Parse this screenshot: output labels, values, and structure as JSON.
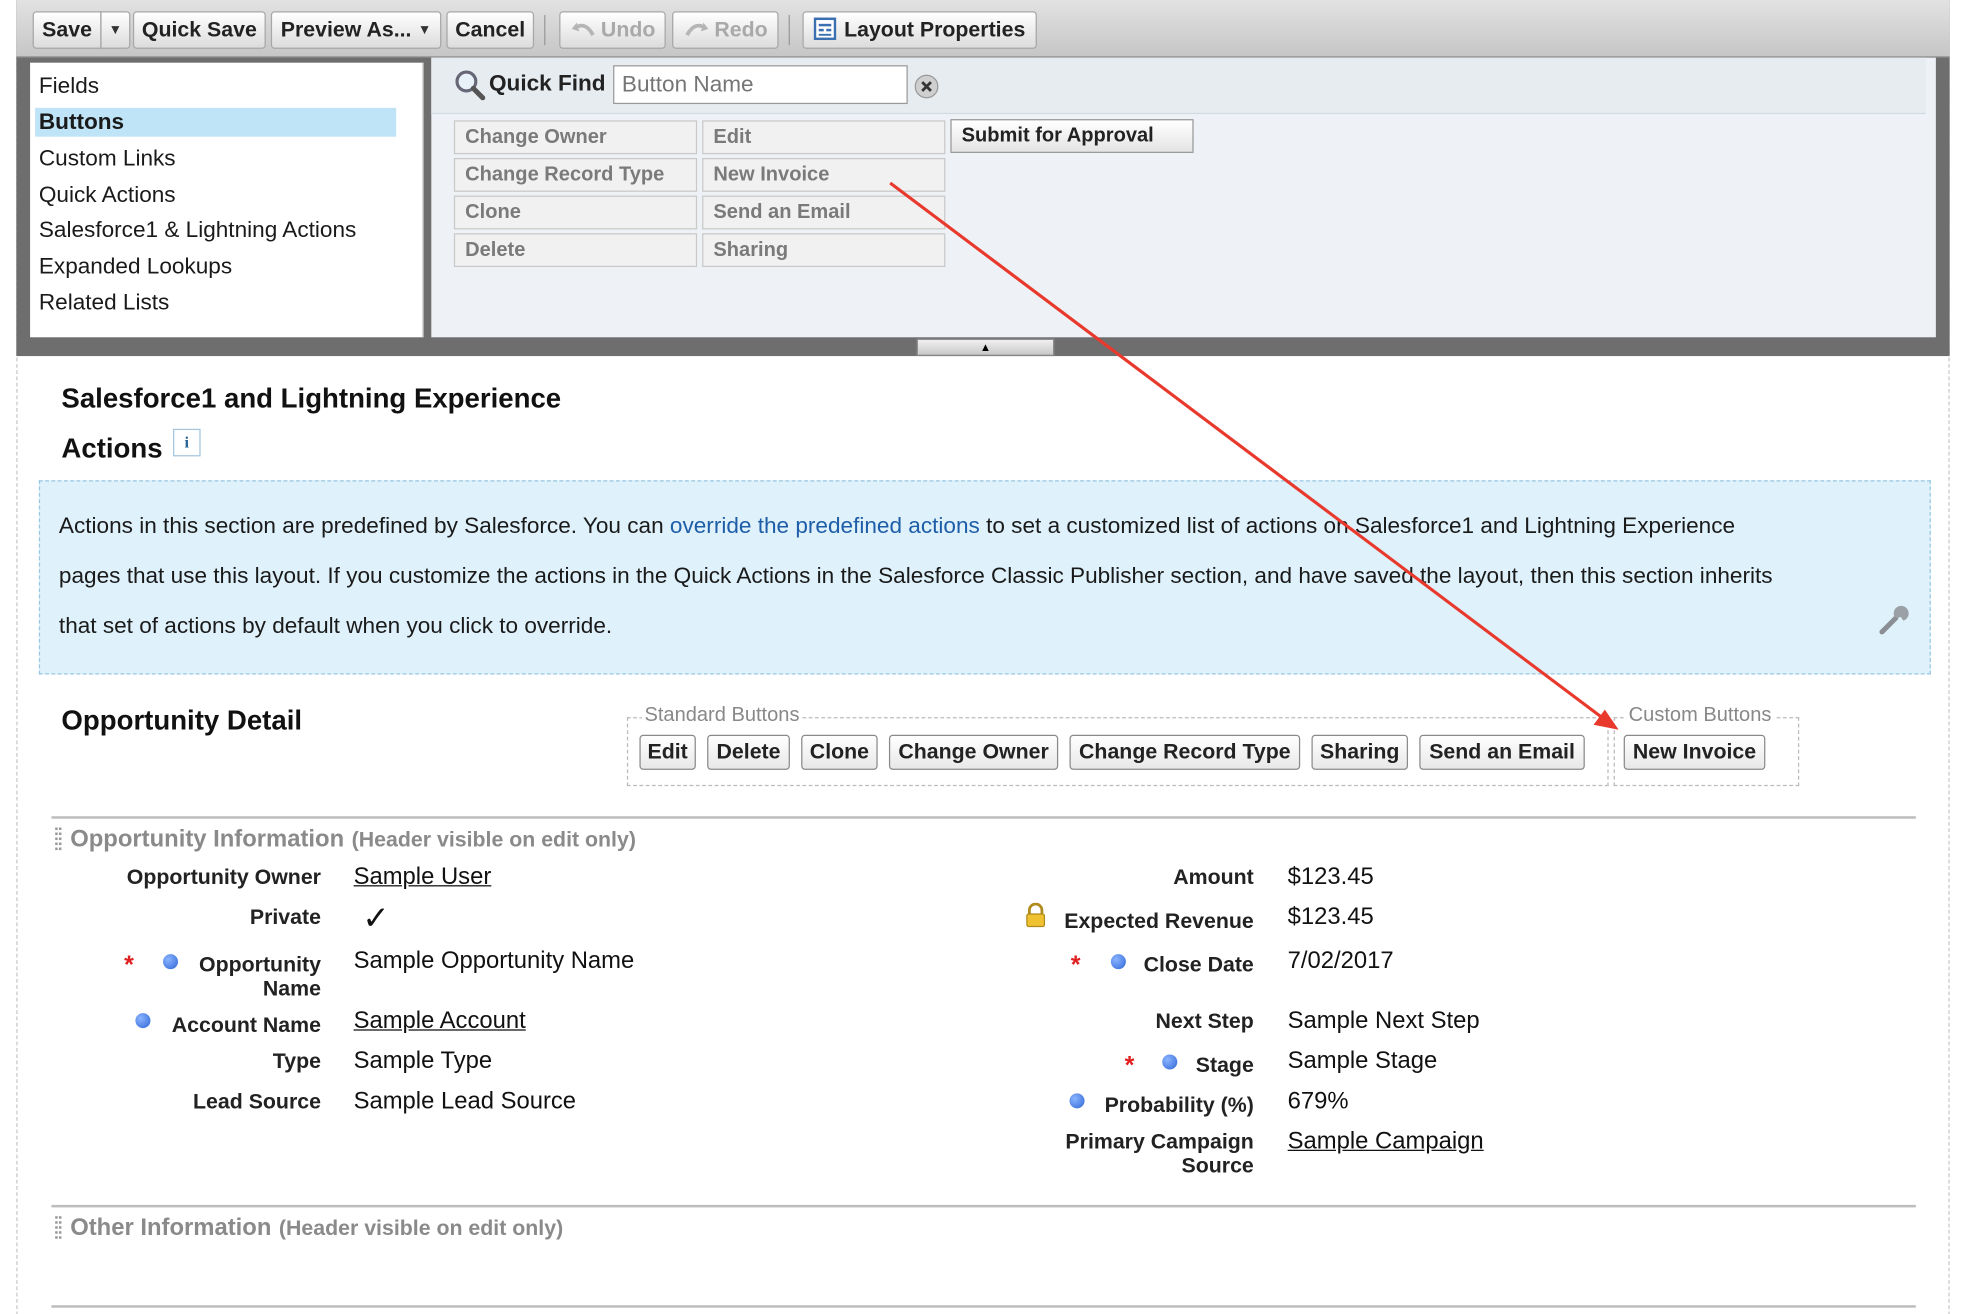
{
  "toolbar": {
    "save": "Save",
    "quick_save": "Quick Save",
    "preview_as": "Preview As...",
    "cancel": "Cancel",
    "undo": "Undo",
    "redo": "Redo",
    "layout_properties": "Layout Properties"
  },
  "palette": {
    "categories": [
      "Fields",
      "Buttons",
      "Custom Links",
      "Quick Actions",
      "Salesforce1 & Lightning Actions",
      "Expanded Lookups",
      "Related Lists"
    ],
    "selected_category": "Buttons",
    "quick_find": {
      "label": "Quick Find",
      "placeholder": "Button Name"
    },
    "buttons_col1": [
      "Change Owner",
      "Change Record Type",
      "Clone",
      "Delete"
    ],
    "buttons_col2": [
      "Edit",
      "New Invoice",
      "Send an Email",
      "Sharing"
    ],
    "buttons_col3": [
      "Submit for Approval"
    ]
  },
  "actions_section": {
    "title": "Salesforce1 and Lightning Experience",
    "subtitle": "Actions",
    "info": "i",
    "notice_line1_a": "Actions in this section are predefined by Salesforce. You can ",
    "notice_link": "override the predefined actions",
    "notice_line1_b": " to set a customized list of actions on Salesforce1 and Lightning Experience",
    "notice_line2": "pages that use this layout. If you customize the actions in the Quick Actions in the Salesforce Classic Publisher section, and have saved the layout, then this section inherits",
    "notice_line3": "that set of actions by default when you click to override."
  },
  "detail": {
    "title": "Opportunity Detail",
    "standard_legend": "Standard Buttons",
    "standard_buttons": [
      "Edit",
      "Delete",
      "Clone",
      "Change Owner",
      "Change Record Type",
      "Sharing",
      "Send an Email"
    ],
    "custom_legend": "Custom Buttons",
    "custom_buttons": [
      "New Invoice"
    ]
  },
  "sections": [
    {
      "title": "Opportunity Information",
      "note": "(Header visible on edit only)"
    },
    {
      "title": "Other Information",
      "note": "(Header visible on edit only)"
    }
  ],
  "fields_left": [
    {
      "label": "Opportunity Owner",
      "value": "Sample User"
    },
    {
      "label": "Private",
      "value": "✓"
    },
    {
      "label": "Opportunity Name",
      "value": "Sample Opportunity Name"
    },
    {
      "label": "Account Name",
      "value": "Sample Account"
    },
    {
      "label": "Type",
      "value": "Sample Type"
    },
    {
      "label": "Lead Source",
      "value": "Sample Lead Source"
    }
  ],
  "fields_right": [
    {
      "label": "Amount",
      "value": "$123.45"
    },
    {
      "label": "Expected Revenue",
      "value": "$123.45"
    },
    {
      "label": "Close Date",
      "value": "7/02/2017"
    },
    {
      "label": "Next Step",
      "value": "Sample Next Step"
    },
    {
      "label": "Stage",
      "value": "Sample Stage"
    },
    {
      "label": "Probability (%)",
      "value": "679%"
    },
    {
      "label": "Primary Campaign Source",
      "value": "Sample Campaign"
    }
  ],
  "colors": {
    "selected": "#bfe3f7",
    "notice_bg": "#dff1fb",
    "link": "#1e5ea8",
    "required": "#e02020",
    "annotation_arrow": "#e8392c"
  },
  "icons": [
    "caret-down-icon",
    "undo-icon",
    "redo-icon",
    "layout-properties-icon",
    "magnifier-icon",
    "clear-icon",
    "info-icon",
    "wrench-icon",
    "lock-icon",
    "checkmark-icon",
    "required-star-icon",
    "blue-dot-icon",
    "splitter-up-icon",
    "annotation-arrow"
  ]
}
